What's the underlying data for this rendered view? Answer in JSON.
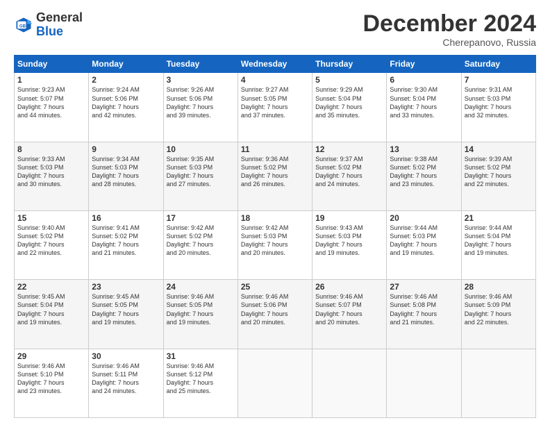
{
  "header": {
    "logo_general": "General",
    "logo_blue": "Blue",
    "month": "December 2024",
    "location": "Cherepanovo, Russia"
  },
  "weekdays": [
    "Sunday",
    "Monday",
    "Tuesday",
    "Wednesday",
    "Thursday",
    "Friday",
    "Saturday"
  ],
  "weeks": [
    [
      {
        "day": "1",
        "sunrise": "9:23 AM",
        "sunset": "5:07 PM",
        "daylight": "7 hours and 44 minutes."
      },
      {
        "day": "2",
        "sunrise": "9:24 AM",
        "sunset": "5:06 PM",
        "daylight": "7 hours and 42 minutes."
      },
      {
        "day": "3",
        "sunrise": "9:26 AM",
        "sunset": "5:06 PM",
        "daylight": "7 hours and 39 minutes."
      },
      {
        "day": "4",
        "sunrise": "9:27 AM",
        "sunset": "5:05 PM",
        "daylight": "7 hours and 37 minutes."
      },
      {
        "day": "5",
        "sunrise": "9:29 AM",
        "sunset": "5:04 PM",
        "daylight": "7 hours and 35 minutes."
      },
      {
        "day": "6",
        "sunrise": "9:30 AM",
        "sunset": "5:04 PM",
        "daylight": "7 hours and 33 minutes."
      },
      {
        "day": "7",
        "sunrise": "9:31 AM",
        "sunset": "5:03 PM",
        "daylight": "7 hours and 32 minutes."
      }
    ],
    [
      {
        "day": "8",
        "sunrise": "9:33 AM",
        "sunset": "5:03 PM",
        "daylight": "7 hours and 30 minutes."
      },
      {
        "day": "9",
        "sunrise": "9:34 AM",
        "sunset": "5:03 PM",
        "daylight": "7 hours and 28 minutes."
      },
      {
        "day": "10",
        "sunrise": "9:35 AM",
        "sunset": "5:03 PM",
        "daylight": "7 hours and 27 minutes."
      },
      {
        "day": "11",
        "sunrise": "9:36 AM",
        "sunset": "5:02 PM",
        "daylight": "7 hours and 26 minutes."
      },
      {
        "day": "12",
        "sunrise": "9:37 AM",
        "sunset": "5:02 PM",
        "daylight": "7 hours and 24 minutes."
      },
      {
        "day": "13",
        "sunrise": "9:38 AM",
        "sunset": "5:02 PM",
        "daylight": "7 hours and 23 minutes."
      },
      {
        "day": "14",
        "sunrise": "9:39 AM",
        "sunset": "5:02 PM",
        "daylight": "7 hours and 22 minutes."
      }
    ],
    [
      {
        "day": "15",
        "sunrise": "9:40 AM",
        "sunset": "5:02 PM",
        "daylight": "7 hours and 22 minutes."
      },
      {
        "day": "16",
        "sunrise": "9:41 AM",
        "sunset": "5:02 PM",
        "daylight": "7 hours and 21 minutes."
      },
      {
        "day": "17",
        "sunrise": "9:42 AM",
        "sunset": "5:02 PM",
        "daylight": "7 hours and 20 minutes."
      },
      {
        "day": "18",
        "sunrise": "9:42 AM",
        "sunset": "5:03 PM",
        "daylight": "7 hours and 20 minutes."
      },
      {
        "day": "19",
        "sunrise": "9:43 AM",
        "sunset": "5:03 PM",
        "daylight": "7 hours and 19 minutes."
      },
      {
        "day": "20",
        "sunrise": "9:44 AM",
        "sunset": "5:03 PM",
        "daylight": "7 hours and 19 minutes."
      },
      {
        "day": "21",
        "sunrise": "9:44 AM",
        "sunset": "5:04 PM",
        "daylight": "7 hours and 19 minutes."
      }
    ],
    [
      {
        "day": "22",
        "sunrise": "9:45 AM",
        "sunset": "5:04 PM",
        "daylight": "7 hours and 19 minutes."
      },
      {
        "day": "23",
        "sunrise": "9:45 AM",
        "sunset": "5:05 PM",
        "daylight": "7 hours and 19 minutes."
      },
      {
        "day": "24",
        "sunrise": "9:46 AM",
        "sunset": "5:05 PM",
        "daylight": "7 hours and 19 minutes."
      },
      {
        "day": "25",
        "sunrise": "9:46 AM",
        "sunset": "5:06 PM",
        "daylight": "7 hours and 20 minutes."
      },
      {
        "day": "26",
        "sunrise": "9:46 AM",
        "sunset": "5:07 PM",
        "daylight": "7 hours and 20 minutes."
      },
      {
        "day": "27",
        "sunrise": "9:46 AM",
        "sunset": "5:08 PM",
        "daylight": "7 hours and 21 minutes."
      },
      {
        "day": "28",
        "sunrise": "9:46 AM",
        "sunset": "5:09 PM",
        "daylight": "7 hours and 22 minutes."
      }
    ],
    [
      {
        "day": "29",
        "sunrise": "9:46 AM",
        "sunset": "5:10 PM",
        "daylight": "7 hours and 23 minutes."
      },
      {
        "day": "30",
        "sunrise": "9:46 AM",
        "sunset": "5:11 PM",
        "daylight": "7 hours and 24 minutes."
      },
      {
        "day": "31",
        "sunrise": "9:46 AM",
        "sunset": "5:12 PM",
        "daylight": "7 hours and 25 minutes."
      },
      null,
      null,
      null,
      null
    ]
  ]
}
